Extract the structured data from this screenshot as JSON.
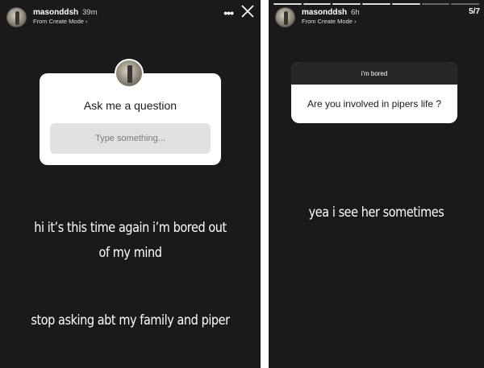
{
  "left_story": {
    "username": "masonddsh",
    "time": "39m",
    "sublabel": "From Create Mode ›",
    "more_icon": "more-horizontal-icon",
    "close_icon": "close-icon",
    "sticker": {
      "title": "Ask me a question",
      "placeholder": "Type something..."
    },
    "caption_line1": "hi it’s this time again i’m bored out",
    "caption_line2": "of my mind",
    "caption_line3": "stop asking abt my family and piper"
  },
  "right_story": {
    "username": "masonddsh",
    "time": "6h",
    "sublabel": "From Create Mode ›",
    "page_counter": "5/7",
    "answer_card": {
      "header": "i'm bored",
      "question": "Are you involved in pipers life ?"
    },
    "caption": "yea i see her sometimes"
  },
  "colors": {
    "story_background": "#1a1a1a",
    "sticker_background": "#ffffff",
    "input_background": "#e1e1e1",
    "answer_header_background": "#262626"
  }
}
